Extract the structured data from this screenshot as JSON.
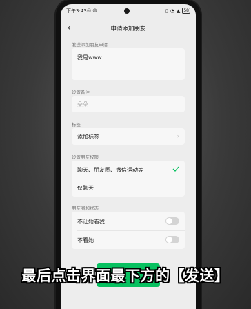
{
  "status": {
    "time": "下午3:43",
    "battery": "58",
    "notification_icons": [
      "notification-icon",
      "notification-icon"
    ],
    "status_icons": [
      "vibrate-icon",
      "wifi-icon",
      "signal-icon",
      "battery-icon"
    ]
  },
  "header": {
    "back_icon": "chevron-left-icon",
    "title": "申请添加朋友"
  },
  "request": {
    "label": "发送添加朋友申请",
    "value": "我是www"
  },
  "remark": {
    "label": "设置备注",
    "placeholder": "朵朵"
  },
  "tags": {
    "label": "标签",
    "item": "添加标签"
  },
  "permissions": {
    "label": "设置朋友权限",
    "options": [
      "聊天、朋友圈、微信运动等",
      "仅聊天"
    ],
    "selected_index": 0
  },
  "moments": {
    "label": "朋友圈和状态",
    "items": [
      {
        "label": "不让她看我",
        "on": false
      },
      {
        "label": "不看她",
        "on": false
      }
    ]
  },
  "caption": "最后点击界面最下方的【发送】",
  "colors": {
    "accent": "#07c160"
  }
}
